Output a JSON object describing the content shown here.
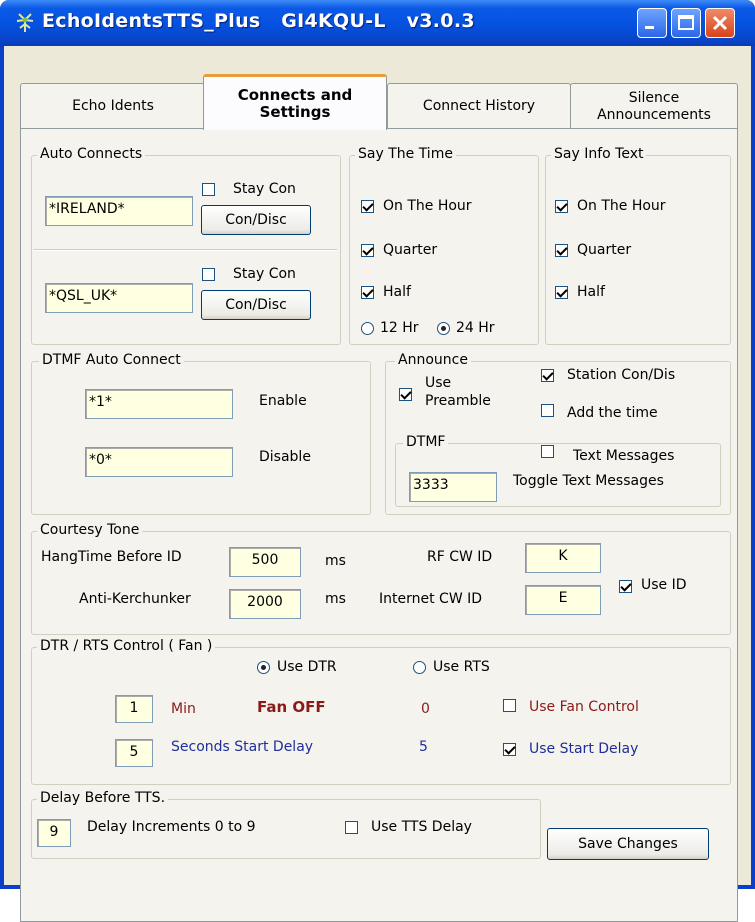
{
  "window": {
    "title": "EchoIdentsTTS_Plus   GI4KQU-L   v3.0.3"
  },
  "tabs": [
    {
      "label": "Echo Idents"
    },
    {
      "label": "Connects and Settings"
    },
    {
      "label": "Connect History"
    },
    {
      "label": "Silence Announcements"
    }
  ],
  "auto_connects": {
    "legend": "Auto Connects",
    "rows": [
      {
        "value": "*IRELAND*",
        "stay_con_label": "Stay Con",
        "stay_con_checked": false,
        "button": "Con/Disc"
      },
      {
        "value": "*QSL_UK*",
        "stay_con_label": "Stay Con",
        "stay_con_checked": false,
        "button": "Con/Disc"
      }
    ]
  },
  "say_time": {
    "legend": "Say The Time",
    "items": [
      {
        "label": "On The Hour",
        "checked": true
      },
      {
        "label": "Quarter",
        "checked": true
      },
      {
        "label": "Half",
        "checked": true
      }
    ],
    "radio_12": "12 Hr",
    "radio_24": "24 Hr",
    "selected_format": "24 Hr"
  },
  "say_info": {
    "legend": "Say Info Text",
    "items": [
      {
        "label": "On The Hour",
        "checked": true
      },
      {
        "label": "Quarter",
        "checked": true
      },
      {
        "label": "Half",
        "checked": true
      }
    ]
  },
  "dtmf_auto": {
    "legend": "DTMF Auto Connect",
    "enable_value": "*1*",
    "enable_label": "Enable",
    "disable_value": "*0*",
    "disable_label": "Disable"
  },
  "announce": {
    "legend": "Announce",
    "use_preamble_line1": "Use",
    "use_preamble_line2": "Preamble",
    "use_preamble_checked": true,
    "station_label": "Station Con/Dis",
    "station_checked": true,
    "add_time_label": "Add the time",
    "add_time_checked": false,
    "dtmf_legend": "DTMF",
    "text_messages_label": "Text Messages",
    "text_messages_checked": false,
    "dtmf_value": "3333",
    "toggle_label": "Toggle Text Messages"
  },
  "courtesy": {
    "legend": "Courtesy Tone",
    "hangtime_label": "HangTime Before ID",
    "hangtime_value": "500",
    "hangtime_unit": "ms",
    "anti_label": "Anti-Kerchunker",
    "anti_value": "2000",
    "anti_unit": "ms",
    "rf_cw_label": "RF CW ID",
    "rf_cw_value": "K",
    "inet_cw_label": "Internet CW ID",
    "inet_cw_value": "E",
    "use_id_label": "Use ID",
    "use_id_checked": true
  },
  "dtr": {
    "legend": "DTR / RTS Control  ( Fan )",
    "use_dtr": "Use DTR",
    "use_rts": "Use RTS",
    "selected": "Use DTR",
    "min_value": "1",
    "min_label": "Min",
    "fan_status": "Fan OFF",
    "fan_count": "0",
    "use_fan_label": "Use Fan Control",
    "use_fan_checked": false,
    "delay_value": "5",
    "delay_label": "Seconds Start Delay",
    "delay_count": "5",
    "use_start_label": "Use Start Delay",
    "use_start_checked": true
  },
  "tts_delay": {
    "legend": "Delay Before TTS.",
    "value": "9",
    "label": "Delay Increments 0 to 9",
    "use_label": "Use TTS Delay",
    "use_checked": false
  },
  "save_button": "Save  Changes",
  "colors": {
    "fan_status": "#8b1a1a",
    "blue_label": "#1f2f99",
    "field_bg": "#ffffe1"
  }
}
